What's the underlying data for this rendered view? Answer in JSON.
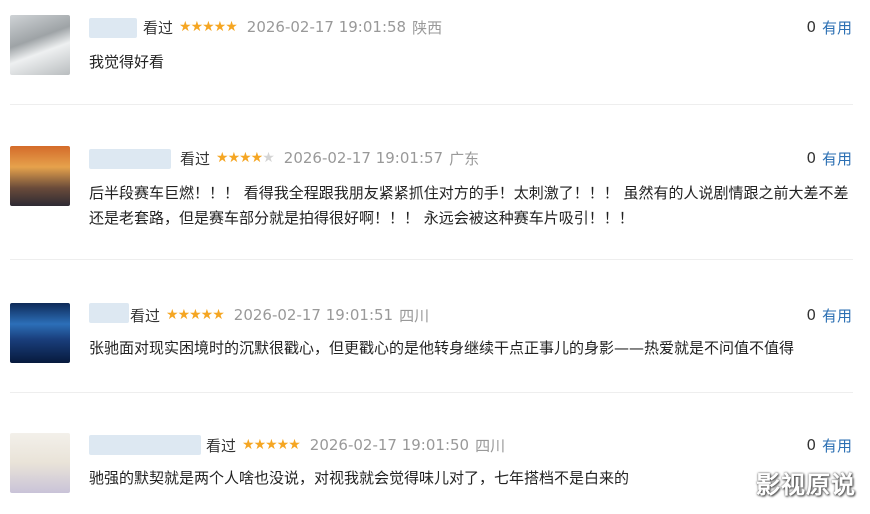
{
  "reviews": [
    {
      "watched_label": "看过",
      "stars_on": "★★★★★",
      "stars_off": "",
      "date": "2026-02-17 19:01:58",
      "region": "陕西",
      "useful_count": "0",
      "useful_label": "有用",
      "content": "我觉得好看"
    },
    {
      "watched_label": "看过",
      "stars_on": "★★★★",
      "stars_off": "★",
      "date": "2026-02-17 19:01:57",
      "region": "广东",
      "useful_count": "0",
      "useful_label": "有用",
      "content": "后半段赛车巨燃！！！ 看得我全程跟我朋友紧紧抓住对方的手！太刺激了！！！ 虽然有的人说剧情跟之前大差不差还是老套路，但是赛车部分就是拍得很好啊！！！ 永远会被这种赛车片吸引！！！"
    },
    {
      "watched_label": "看过",
      "stars_on": "★★★★★",
      "stars_off": "",
      "date": "2026-02-17 19:01:51",
      "region": "四川",
      "useful_count": "0",
      "useful_label": "有用",
      "content": "张驰面对现实困境时的沉默很戳心，但更戳心的是他转身继续干点正事儿的身影——热爱就是不问值不值得"
    },
    {
      "watched_label": "看过",
      "stars_on": "★★★★★",
      "stars_off": "",
      "date": "2026-02-17 19:01:50",
      "region": "四川",
      "useful_count": "0",
      "useful_label": "有用",
      "content": "驰强的默契就是两个人啥也没说，对视我就会觉得味儿对了，七年搭档不是白来的"
    }
  ],
  "watermark": "影视原说",
  "colors": {
    "star": "#f5a623",
    "link": "#2b6fb3",
    "meta": "#999999"
  }
}
